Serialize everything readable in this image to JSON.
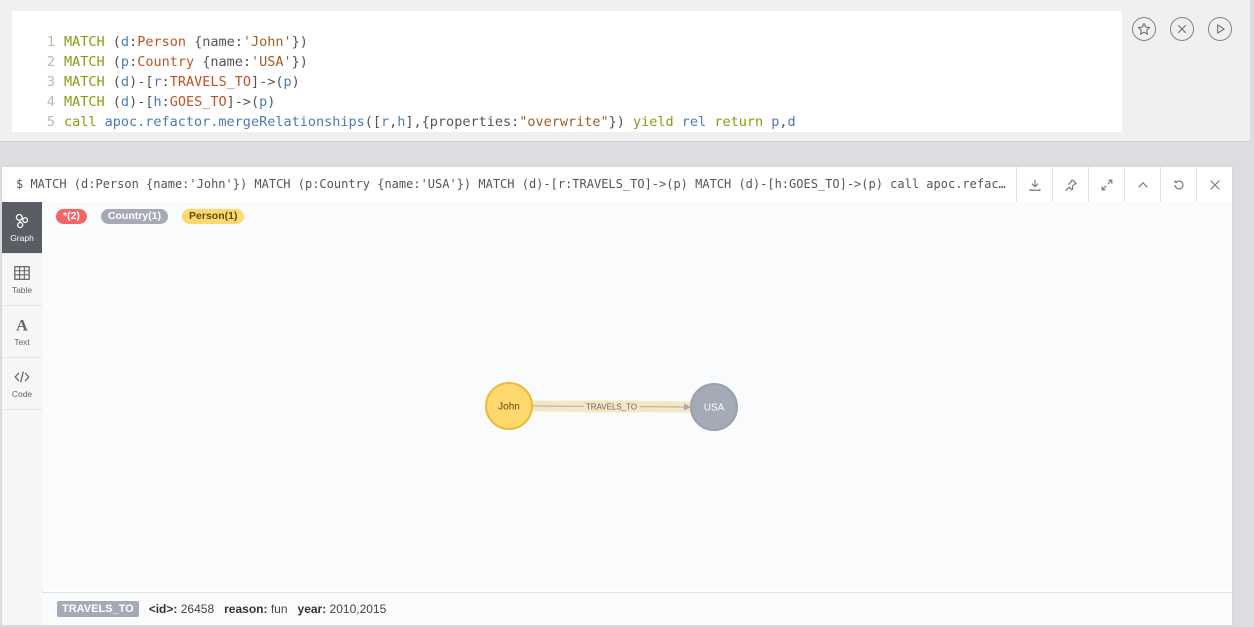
{
  "editor": {
    "lines": [
      {
        "num": "1",
        "tokens": [
          [
            "kw",
            "MATCH "
          ],
          [
            "punc",
            "("
          ],
          [
            "var",
            "d"
          ],
          [
            "punc",
            ":"
          ],
          [
            "lbl",
            "Person"
          ],
          [
            "punc",
            " {name:"
          ],
          [
            "str",
            "'John'"
          ],
          [
            "punc",
            "})"
          ]
        ]
      },
      {
        "num": "2",
        "tokens": [
          [
            "kw",
            "MATCH "
          ],
          [
            "punc",
            "("
          ],
          [
            "var",
            "p"
          ],
          [
            "punc",
            ":"
          ],
          [
            "lbl",
            "Country"
          ],
          [
            "punc",
            " {name:"
          ],
          [
            "str",
            "'USA'"
          ],
          [
            "punc",
            "})"
          ]
        ]
      },
      {
        "num": "3",
        "tokens": [
          [
            "kw",
            "MATCH "
          ],
          [
            "punc",
            "("
          ],
          [
            "var",
            "d"
          ],
          [
            "punc",
            ")-["
          ],
          [
            "var",
            "r"
          ],
          [
            "punc",
            ":"
          ],
          [
            "lbl",
            "TRAVELS_TO"
          ],
          [
            "punc",
            "]->("
          ],
          [
            "var",
            "p"
          ],
          [
            "punc",
            ")"
          ]
        ]
      },
      {
        "num": "4",
        "tokens": [
          [
            "kw",
            "MATCH "
          ],
          [
            "punc",
            "("
          ],
          [
            "var",
            "d"
          ],
          [
            "punc",
            ")-["
          ],
          [
            "var",
            "h"
          ],
          [
            "punc",
            ":"
          ],
          [
            "lbl",
            "GOES_TO"
          ],
          [
            "punc",
            "]->("
          ],
          [
            "var",
            "p"
          ],
          [
            "punc",
            ")"
          ]
        ]
      },
      {
        "num": "5",
        "tokens": [
          [
            "kw",
            "call "
          ],
          [
            "fn",
            "apoc.refactor.mergeRelationships"
          ],
          [
            "punc",
            "(["
          ],
          [
            "var",
            "r"
          ],
          [
            "punc",
            ","
          ],
          [
            "var",
            "h"
          ],
          [
            "punc",
            "],{properties:"
          ],
          [
            "str",
            "\"overwrite\""
          ],
          [
            "punc",
            "}) "
          ],
          [
            "kw",
            "yield "
          ],
          [
            "var",
            "rel "
          ],
          [
            "kw",
            "return "
          ],
          [
            "var",
            "p"
          ],
          [
            "punc",
            ","
          ],
          [
            "var",
            "d"
          ]
        ]
      }
    ],
    "actions": [
      {
        "name": "favorite-button",
        "icon": "star-icon"
      },
      {
        "name": "clear-button",
        "icon": "close-circle-icon"
      },
      {
        "name": "run-button",
        "icon": "play-icon"
      }
    ]
  },
  "result": {
    "query": "$ MATCH (d:Person {name:'John'}) MATCH (p:Country {name:'USA'}) MATCH (d)-[r:TRAVELS_TO]->(p) MATCH (d)-[h:GOES_TO]->(p) call apoc.refactor....",
    "header_actions": [
      "download-icon",
      "pin-icon",
      "expand-icon",
      "collapse-icon",
      "rerun-icon",
      "close-icon"
    ],
    "tabs": [
      {
        "label": "Graph",
        "icon": "graph-icon",
        "active": true
      },
      {
        "label": "Table",
        "icon": "table-icon",
        "active": false
      },
      {
        "label": "Text",
        "icon": "text-icon",
        "active": false
      },
      {
        "label": "Code",
        "icon": "code-icon",
        "active": false
      }
    ],
    "legend": {
      "all": "*(2)",
      "country": "Country(1)",
      "person": "Person(1)"
    },
    "graph": {
      "nodes": [
        {
          "id": "john",
          "label": "John",
          "type": "Person",
          "color": "#ffd86e",
          "stroke": "#edba39",
          "text_color": "#604a0e"
        },
        {
          "id": "usa",
          "label": "USA",
          "type": "Country",
          "color": "#a5abb6",
          "stroke": "#9aa1ac",
          "text_color": "#ffffff"
        }
      ],
      "relationship": {
        "label": "TRAVELS_TO",
        "from": "john",
        "to": "usa",
        "highlight": "#f5e7c2",
        "line": "#a5abb6"
      }
    },
    "status": {
      "badge": "TRAVELS_TO",
      "props": [
        {
          "key": "<id>:",
          "value": "26458"
        },
        {
          "key": "reason:",
          "value": "fun"
        },
        {
          "key": "year:",
          "value": "2010,2015"
        }
      ]
    }
  }
}
